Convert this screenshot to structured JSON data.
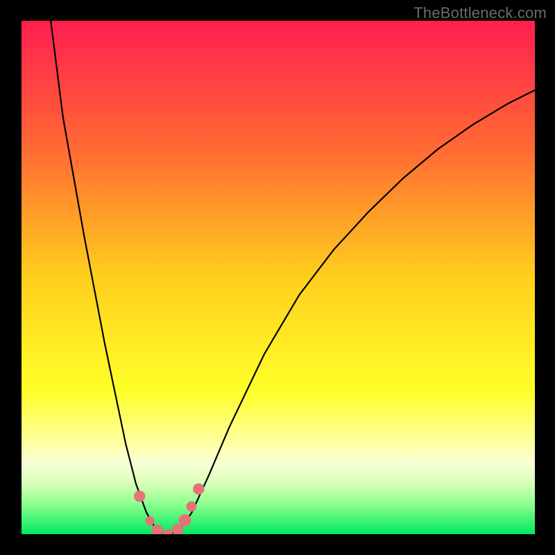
{
  "watermark": "TheBottleneck.com",
  "chart_data": {
    "type": "line",
    "title": "",
    "xlabel": "",
    "ylabel": "",
    "xlim": [
      0,
      100
    ],
    "ylim": [
      0,
      100
    ],
    "grid": false,
    "gradient_stops": [
      {
        "pos": 0.0,
        "color": "#ff1f4f"
      },
      {
        "pos": 0.25,
        "color": "#ff6a33"
      },
      {
        "pos": 0.5,
        "color": "#ffcf1e"
      },
      {
        "pos": 0.72,
        "color": "#ffff28"
      },
      {
        "pos": 0.82,
        "color": "#ffff9f"
      },
      {
        "pos": 0.86,
        "color": "#faffd7"
      },
      {
        "pos": 0.9,
        "color": "#d9ffba"
      },
      {
        "pos": 0.94,
        "color": "#8fff8f"
      },
      {
        "pos": 1.0,
        "color": "#00e862"
      }
    ],
    "series": [
      {
        "name": "bottleneck-curve",
        "x": [
          5.7,
          8.1,
          12.2,
          16.2,
          20.3,
          22.3,
          24.3,
          25.7,
          27.0,
          28.4,
          29.7,
          31.1,
          33.1,
          36.5,
          40.5,
          47.3,
          54.1,
          60.8,
          67.6,
          74.3,
          81.1,
          87.8,
          94.6,
          100.0
        ],
        "y": [
          100.0,
          81.1,
          58.1,
          37.2,
          17.6,
          9.8,
          4.3,
          1.8,
          0.4,
          0.0,
          0.3,
          1.4,
          4.1,
          11.5,
          20.9,
          35.1,
          46.6,
          55.4,
          62.8,
          69.3,
          75.0,
          79.7,
          83.8,
          86.5
        ]
      }
    ],
    "markers": [
      {
        "x": 23.0,
        "y": 7.4,
        "r": 1.1
      },
      {
        "x": 25.0,
        "y": 2.6,
        "r": 0.9
      },
      {
        "x": 26.4,
        "y": 0.8,
        "r": 1.1
      },
      {
        "x": 28.4,
        "y": 0.0,
        "r": 1.0
      },
      {
        "x": 30.4,
        "y": 0.9,
        "r": 1.1
      },
      {
        "x": 31.8,
        "y": 2.7,
        "r": 1.2
      },
      {
        "x": 33.1,
        "y": 5.4,
        "r": 1.0
      },
      {
        "x": 34.5,
        "y": 8.8,
        "r": 1.1
      }
    ],
    "marker_color": "#e57373"
  }
}
